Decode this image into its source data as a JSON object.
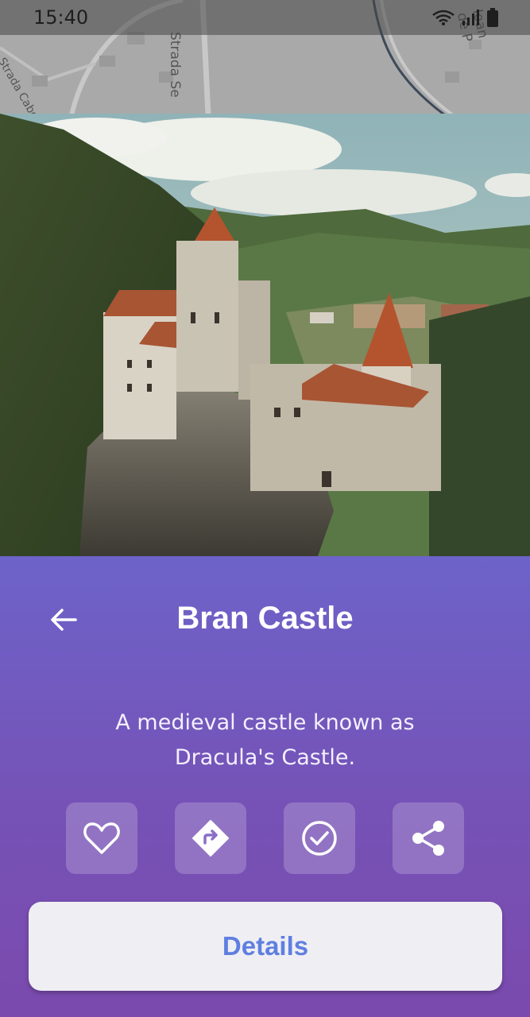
{
  "status_bar": {
    "time": "15:40",
    "icons": [
      "wifi-icon",
      "signal-icon",
      "battery-icon"
    ]
  },
  "map": {
    "labels": [
      "Strada Se",
      "Strada Cabe",
      "Ioan de P"
    ]
  },
  "place": {
    "name": "Bran Castle",
    "description": "A medieval castle known as Dracula's Castle."
  },
  "actions": [
    {
      "name": "favorite",
      "icon": "heart-icon"
    },
    {
      "name": "directions",
      "icon": "directions-icon"
    },
    {
      "name": "visited",
      "icon": "check-circle-icon"
    },
    {
      "name": "share",
      "icon": "share-icon"
    }
  ],
  "buttons": {
    "details_label": "Details"
  },
  "colors": {
    "panel_top": "#6d63c9",
    "panel_bottom": "#7b4aae",
    "details_text": "#5f7fe0",
    "details_bg": "#efeef3"
  }
}
